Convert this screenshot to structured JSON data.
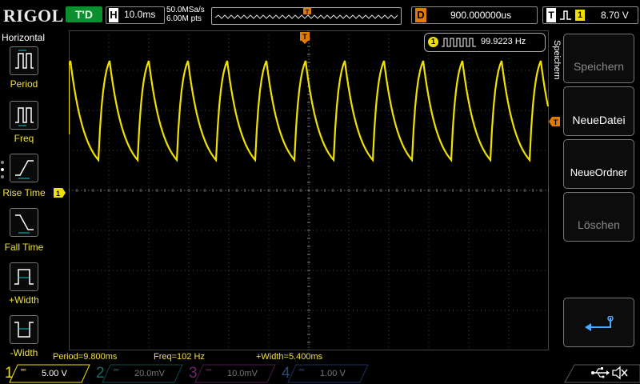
{
  "header": {
    "brand": "RIGOL",
    "trigger_state": "T'D",
    "timebase_label": "H",
    "timebase_value": "10.0ms",
    "sample_rate": "50.0MSa/s",
    "memory_depth": "6.00M pts",
    "delay_label": "D",
    "delay_value": "900.000000us",
    "trigger_label": "T",
    "trigger_source": "1",
    "trigger_level": "8.70 V"
  },
  "left_menu": {
    "title": "Horizontal",
    "items": [
      {
        "label": "Period",
        "icon": "period-icon"
      },
      {
        "label": "Freq",
        "icon": "frequency-icon"
      },
      {
        "label": "Rise Time",
        "icon": "rise-time-icon"
      },
      {
        "label": "Fall Time",
        "icon": "fall-time-icon"
      },
      {
        "label": "+Width",
        "icon": "positive-width-icon"
      },
      {
        "label": "-Width",
        "icon": "negative-width-icon"
      }
    ]
  },
  "right_menu": {
    "title": "Speichern",
    "buttons": [
      {
        "label": "Speichern",
        "enabled": false
      },
      {
        "label": "NeueDatei",
        "enabled": true
      },
      {
        "label": "NeueOrdner",
        "enabled": true
      },
      {
        "label": "Löschen",
        "enabled": false
      },
      {
        "label": "",
        "enabled": true,
        "icon": "return-arrow-icon"
      }
    ]
  },
  "frequency_counter": {
    "channel": "1",
    "value": "99.9223 Hz"
  },
  "measurements": [
    "Period=9.800ms",
    "Freq=102 Hz",
    "+Width=5.400ms"
  ],
  "channels": [
    {
      "number": "1",
      "value": "5.00 V",
      "color": "#f0e000",
      "active": true
    },
    {
      "number": "2",
      "value": "20.0mV",
      "color": "#1aa6a6",
      "active": false
    },
    {
      "number": "3",
      "value": "10.0mV",
      "color": "#c030c0",
      "active": false
    },
    {
      "number": "4",
      "value": "1.00 V",
      "color": "#2a6ad0",
      "active": false
    }
  ],
  "waveform": {
    "color": "#f0e000",
    "cycles_visible": 12,
    "shape": "sawtooth-exponential"
  },
  "markers": {
    "trigger_marker": "T",
    "channel_marker": "1"
  },
  "colors": {
    "accent": "#f0e000",
    "trigger_orange": "#e07a00",
    "grid": "#444444"
  }
}
